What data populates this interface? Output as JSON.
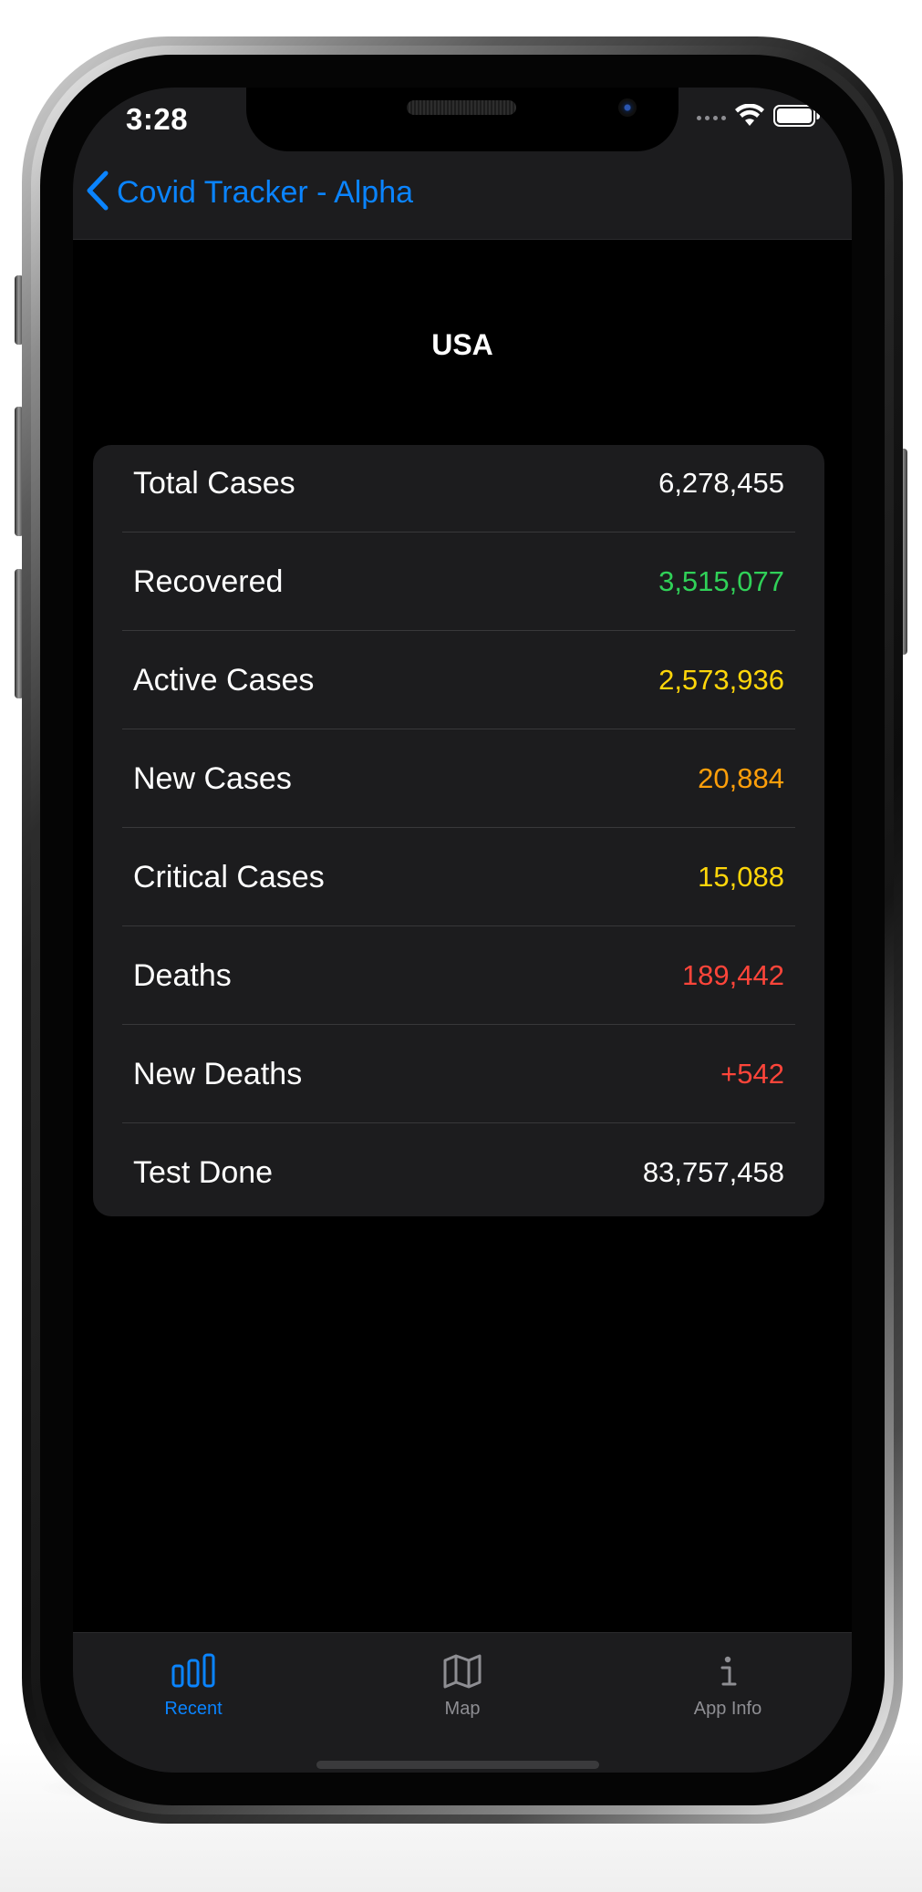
{
  "status_bar": {
    "time": "3:28"
  },
  "nav": {
    "back_label": "Covid Tracker - Alpha"
  },
  "country": "USA",
  "stats": [
    {
      "label": "Total Cases",
      "value": "6,278,455",
      "color": "#ffffff"
    },
    {
      "label": "Recovered",
      "value": "3,515,077",
      "color": "#30d158"
    },
    {
      "label": "Active Cases",
      "value": "2,573,936",
      "color": "#ffd60a"
    },
    {
      "label": "New Cases",
      "value": "20,884",
      "color": "#ff9f0a"
    },
    {
      "label": "Critical Cases",
      "value": "15,088",
      "color": "#ffd60a"
    },
    {
      "label": "Deaths",
      "value": "189,442",
      "color": "#ff453a"
    },
    {
      "label": "New Deaths",
      "value": "+542",
      "color": "#ff453a"
    },
    {
      "label": "Test Done",
      "value": "83,757,458",
      "color": "#ffffff"
    }
  ],
  "tabs": [
    {
      "label": "Recent",
      "icon": "bar-chart-icon",
      "active": true
    },
    {
      "label": "Map",
      "icon": "map-icon",
      "active": false
    },
    {
      "label": "App Info",
      "icon": "info-icon",
      "active": false
    }
  ],
  "colors": {
    "accent": "#0a84ff",
    "inactive": "#8e8e93",
    "background": "#000000",
    "card": "#1c1c1e"
  }
}
